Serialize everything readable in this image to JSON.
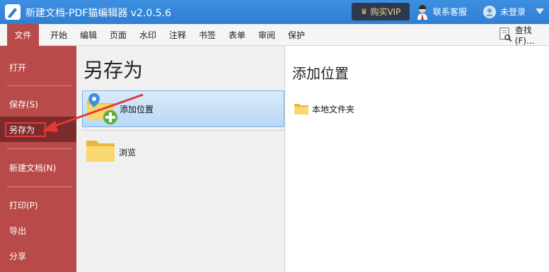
{
  "app": {
    "title": "新建文档-PDF猫编辑器 v2.0.5.6"
  },
  "titlebar": {
    "vip_label": "购买VIP",
    "service_label": "联系客服",
    "login_label": "未登录"
  },
  "menubar": {
    "file_label": "文件",
    "tabs": [
      "开始",
      "编辑",
      "页面",
      "水印",
      "注释",
      "书签",
      "表单",
      "审阅",
      "保护"
    ],
    "find_label": "查找(F)..."
  },
  "file_menu": {
    "items": [
      "打开",
      "保存(S)",
      "另存为",
      "新建文档(N)",
      "打印(P)",
      "导出",
      "分享"
    ],
    "active": "另存为"
  },
  "save_as": {
    "title": "另存为",
    "options": [
      "添加位置",
      "浏览"
    ]
  },
  "locations": {
    "title": "添加位置",
    "items": [
      "本地文件夹"
    ]
  },
  "colors": {
    "titlebar_blue": "#2f7fd3",
    "file_red": "#b94a4a",
    "active_dark_red": "#7c2b2b",
    "annotation_red": "#e23a3a"
  },
  "icons": [
    "app-logo-icon",
    "crown-icon",
    "customer-service-icon",
    "user-icon",
    "chevron-down-icon",
    "find-icon",
    "folder-add-icon",
    "folder-icon"
  ]
}
